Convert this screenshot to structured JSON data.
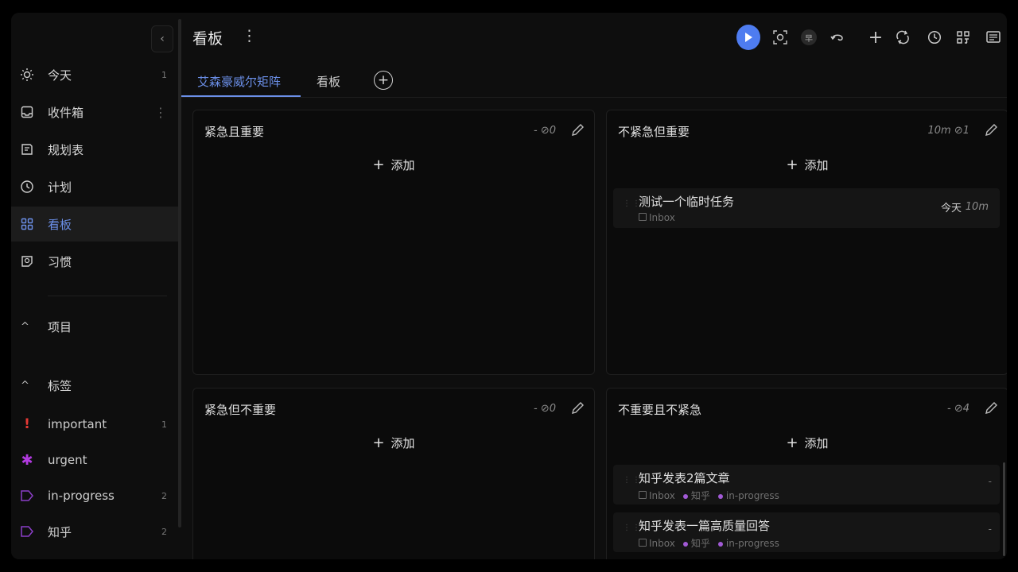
{
  "sidebar": {
    "collapse_icon": "chevron-left-icon",
    "nav": [
      {
        "label": "今天",
        "count": "1",
        "icon": "sun-icon"
      },
      {
        "label": "收件箱",
        "icon": "inbox-icon",
        "more": "⋮"
      },
      {
        "label": "规划表",
        "icon": "planner-icon"
      },
      {
        "label": "计划",
        "icon": "clock-icon"
      },
      {
        "label": "看板",
        "icon": "grid-icon",
        "active": true
      },
      {
        "label": "习惯",
        "icon": "habit-icon"
      }
    ],
    "projects_label": "项目",
    "tags_label": "标签",
    "tags": [
      {
        "label": "important",
        "count": "1",
        "icon": "exclamation-icon",
        "color": "#e53935"
      },
      {
        "label": "urgent",
        "icon": "asterisk-icon",
        "color": "#b23ae0"
      },
      {
        "label": "in-progress",
        "count": "2",
        "icon": "tag-icon",
        "color": "#8b3fc8"
      },
      {
        "label": "知乎",
        "count": "2",
        "icon": "tag-icon",
        "color": "#8b3fc8"
      }
    ]
  },
  "header": {
    "title": "看板",
    "more": "⋮",
    "toolbar_icons": [
      "play-icon",
      "focus-icon",
      "badge-icon",
      "undo-icon",
      "plus-icon",
      "sync-icon",
      "history-icon",
      "apps-icon",
      "notes-icon"
    ],
    "badge_text": "早"
  },
  "tabs": [
    {
      "label": "艾森豪威尔矩阵",
      "active": true
    },
    {
      "label": "看板"
    }
  ],
  "add_label": "添加",
  "quadrants": [
    {
      "title": "紧急且重要",
      "time": "-",
      "done": "0",
      "tasks": []
    },
    {
      "title": "不紧急但重要",
      "time": "10m",
      "done": "1",
      "tasks": [
        {
          "name": "测试一个临时任务",
          "project": "Inbox",
          "today": "今天",
          "duration": "10m"
        }
      ]
    },
    {
      "title": "紧急但不重要",
      "time": "-",
      "done": "0",
      "tasks": []
    },
    {
      "title": "不重要且不紧急",
      "time": "-",
      "done": "4",
      "tasks": [
        {
          "name": "知乎发表2篇文章",
          "project": "Inbox",
          "tags": [
            "知乎",
            "in-progress"
          ],
          "duration": "-"
        },
        {
          "name": "知乎发表一篇高质量回答",
          "project": "Inbox",
          "tags": [
            "知乎",
            "in-progress"
          ],
          "duration": "-"
        }
      ]
    }
  ],
  "colors": {
    "accent": "#6b8fe8",
    "play": "#4e7cf0",
    "tag_purple": "#a25ad6"
  }
}
